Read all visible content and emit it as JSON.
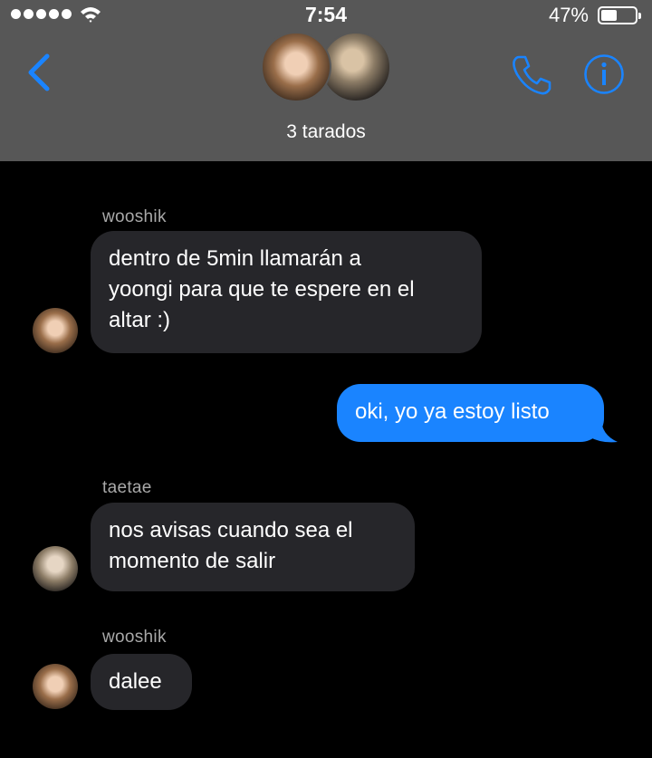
{
  "status": {
    "time": "7:54",
    "battery": "47%",
    "battery_level": 0.47
  },
  "header": {
    "group_name": "3 tarados"
  },
  "colors": {
    "header_bg": "#575757",
    "accent_blue": "#1a84ff",
    "incoming_bubble": "#26262a"
  },
  "messages": [
    {
      "sender": "wooshik",
      "text_lines": [
        "dentro de 5min llamarán a",
        "yoongi para que te espere en el",
        "altar :)"
      ],
      "direction": "incoming"
    },
    {
      "text": "oki, yo ya estoy listo",
      "direction": "outgoing"
    },
    {
      "sender": "taetae",
      "text_lines": [
        "nos avisas cuando sea el",
        "momento de salir"
      ],
      "direction": "incoming"
    },
    {
      "sender": "wooshik",
      "text": "dalee",
      "direction": "incoming"
    }
  ]
}
